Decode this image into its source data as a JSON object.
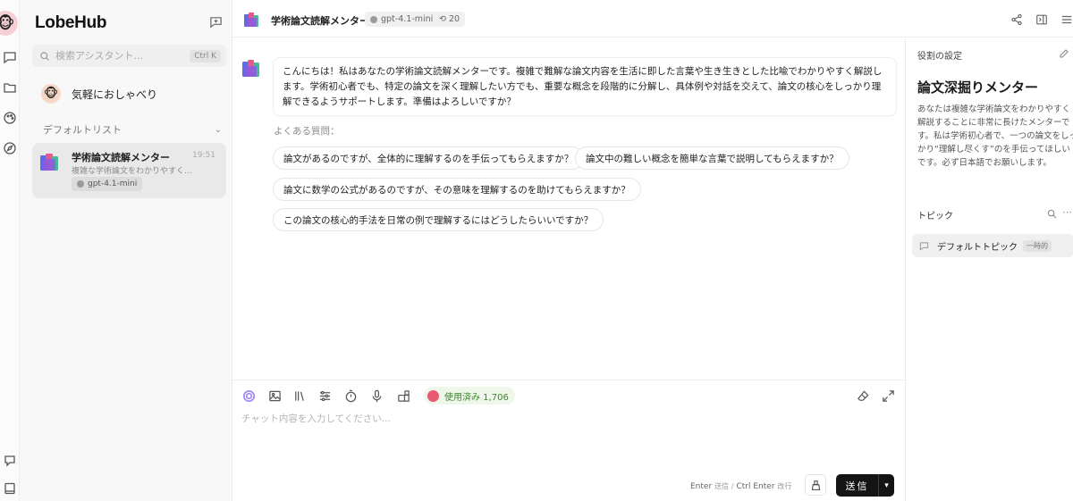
{
  "app": {
    "brand": "LobeHub"
  },
  "sidebar": {
    "search_placeholder": "検索アシスタント...",
    "search_shortcut": "Ctrl K",
    "inbox_label": "気軽におしゃべり",
    "group_label": "デフォルトリスト",
    "session": {
      "title": "学術論文読解メンター",
      "time": "19:51",
      "description": "複雑な学術論文をわかりやすく...",
      "model": "gpt-4.1-mini"
    }
  },
  "header": {
    "title": "学術論文読解メンター",
    "model": "gpt-4.1-mini",
    "history_count": "20"
  },
  "chat": {
    "greeting": "こんにちは！私はあなたの学術論文読解メンターです。複雑で難解な論文内容を生活に即した言葉や生き生きとした比喩でわかりやすく解説します。学術初心者でも、特定の論文を深く理解したい方でも、重要な概念を段階的に分解し、具体例や対話を交えて、論文の核心をしっかり理解できるようサポートします。準備はよろしいですか？",
    "faq_label": "よくある質問：",
    "questions": [
      "論文があるのですが、全体的に理解するのを手伝ってもらえますか？",
      "論文中の難しい概念を簡単な言葉で説明してもらえますか？",
      "論文に数学の公式があるのですが、その意味を理解するのを助けてもらえますか？",
      "この論文の核心的手法を日常の例で理解するにはどうしたらいいですか？"
    ]
  },
  "composer": {
    "usage_label": "使用済み 1,706",
    "placeholder": "チャット内容を入力してください...",
    "hint_send_key": "Enter",
    "hint_send_label": "送信",
    "hint_sep": "/",
    "hint_newline_key": "Ctrl Enter",
    "hint_newline_label": "改行",
    "send_label": "送信"
  },
  "right_panel": {
    "role_header": "役割の設定",
    "role_name": "論文深掘りメンター",
    "role_desc": "あなたは複雑な学術論文をわかりやすく解説することに非常に長けたメンターです。私は学術初心者で、一つの論文をしっかり“理解し尽くす”のを手伝ってほしいです。必ず日本語でお願いします。",
    "topic_header": "トピック",
    "topic_name": "デフォルトトピック",
    "topic_badge": "一時的"
  },
  "colors": {
    "accent_purple": "#8b5cf6",
    "usage_green": "#3a8a2a",
    "send_bg": "#141414"
  },
  "icons": [
    "chat-icon",
    "folder-icon",
    "palette-icon",
    "compass-icon",
    "feedback-icon",
    "book-icon",
    "new-chat-icon",
    "search-icon",
    "share-icon",
    "panel-icon",
    "menu-icon",
    "image-icon",
    "library-icon",
    "settings-icon",
    "timer-icon",
    "mic-icon",
    "plugin-icon",
    "eraser-icon",
    "expand-icon",
    "edit-icon",
    "more-icon"
  ]
}
